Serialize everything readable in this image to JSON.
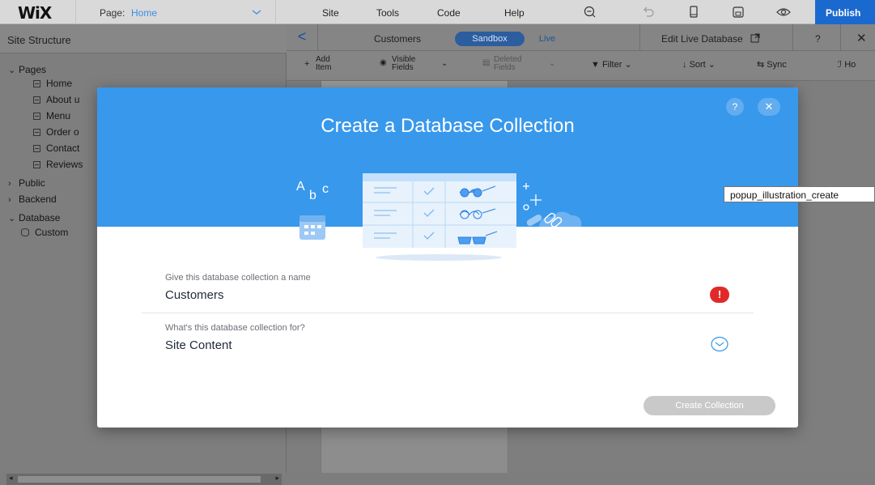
{
  "topbar": {
    "logo": "WiX",
    "page_label": "Page:",
    "page_value": "Home",
    "menu": [
      "Site",
      "Tools",
      "Code",
      "Help"
    ],
    "publish": "Publish"
  },
  "left_panel": {
    "title": "Site Structure",
    "pages_label": "Pages",
    "pages": [
      "Home",
      "About u",
      "Menu",
      "Order o",
      "Contact",
      "Reviews"
    ],
    "public_label": "Public",
    "backend_label": "Backend",
    "database_label": "Database",
    "database_items": [
      "Custom"
    ]
  },
  "db_panel": {
    "collection": "Customers",
    "sandbox": "Sandbox",
    "live": "Live",
    "edit_live": "Edit Live Database",
    "help": "?",
    "toolbar": {
      "add_item": [
        "Add",
        "Item"
      ],
      "visible_fields": [
        "Visible",
        "Fields"
      ],
      "deleted_fields": [
        "Deleted",
        "Fields"
      ],
      "filter": "Filter",
      "sort": "Sort",
      "sync": "Sync",
      "hooks": "Ho"
    }
  },
  "modal": {
    "title": "Create a Database Collection",
    "help": "?",
    "close": "✕",
    "name_label": "Give this database collection a name",
    "name_value": "Customers",
    "error_icon": "!",
    "purpose_label": "What's this database collection for?",
    "purpose_value": "Site Content",
    "create_button": "Create Collection",
    "illustration_letters": [
      "A",
      "b",
      "c"
    ]
  },
  "tooltip": "popup_illustration_create",
  "colors": {
    "modal_header": "#3898ec",
    "publish": "#1a69cf",
    "error": "#e02a2a",
    "page_value": "#3a8ee6"
  }
}
